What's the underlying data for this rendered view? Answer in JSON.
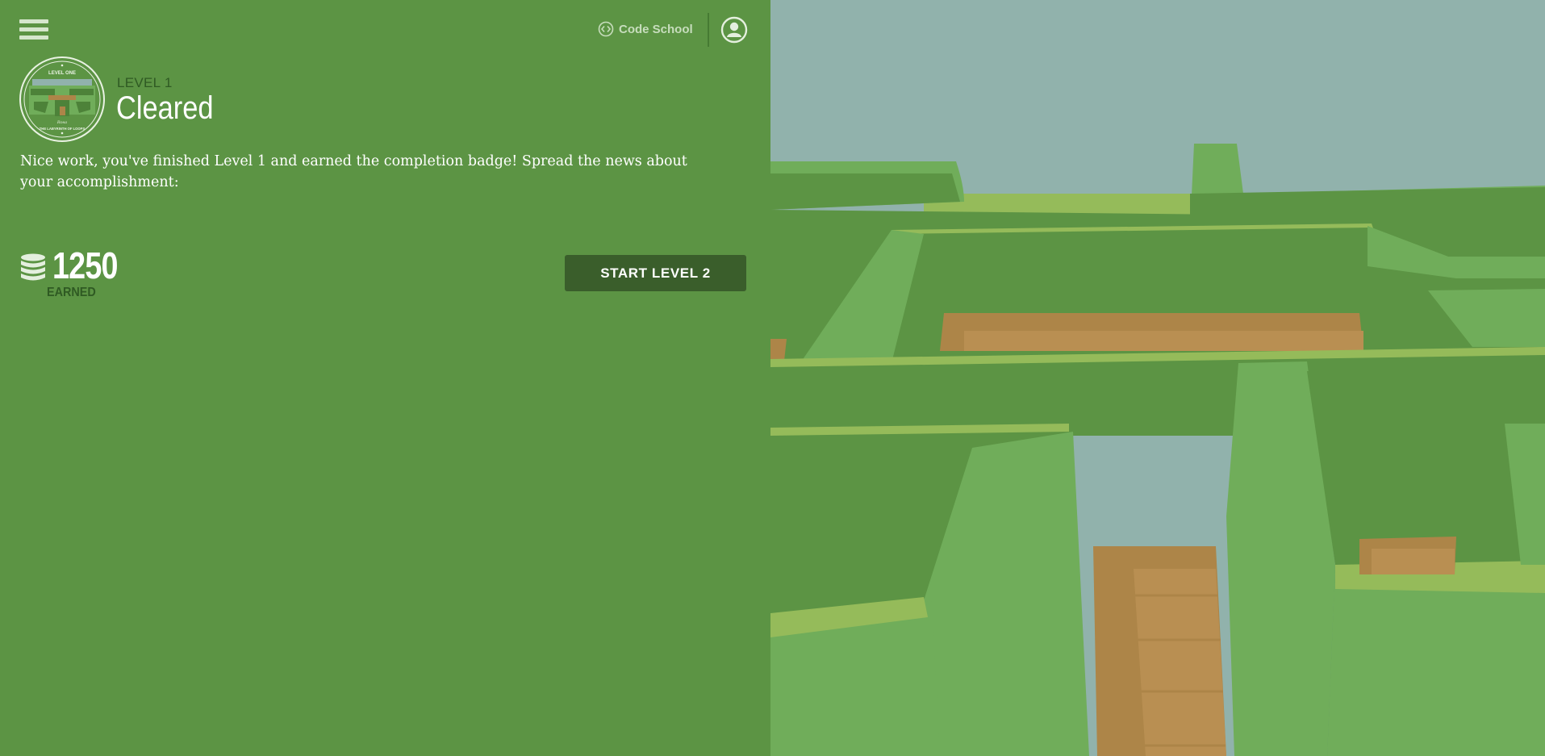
{
  "header": {
    "brand_name": "Code School",
    "icons": [
      "menu-icon",
      "code-school-icon",
      "account-icon"
    ]
  },
  "level": {
    "label": "LEVEL 1",
    "status": "Cleared",
    "badge": {
      "top_text": "LEVEL ONE",
      "script_text": "Rosa",
      "bottom_text": "THE LABYRINTH OF LOOPS"
    }
  },
  "message": "Nice work, you've finished Level 1 and earned the completion badge! Spread the news about your accomplishment:",
  "coins": {
    "value": "1250",
    "label": "EARNED"
  },
  "actions": {
    "start_next": "START LEVEL 2"
  },
  "colors": {
    "panel": "#5c9444",
    "sky": "#91b2ac",
    "button": "#3a5e2b",
    "hedge_light": "#70ad5a",
    "hedge_dark": "#5c9444",
    "dirt": "#ad8548"
  }
}
